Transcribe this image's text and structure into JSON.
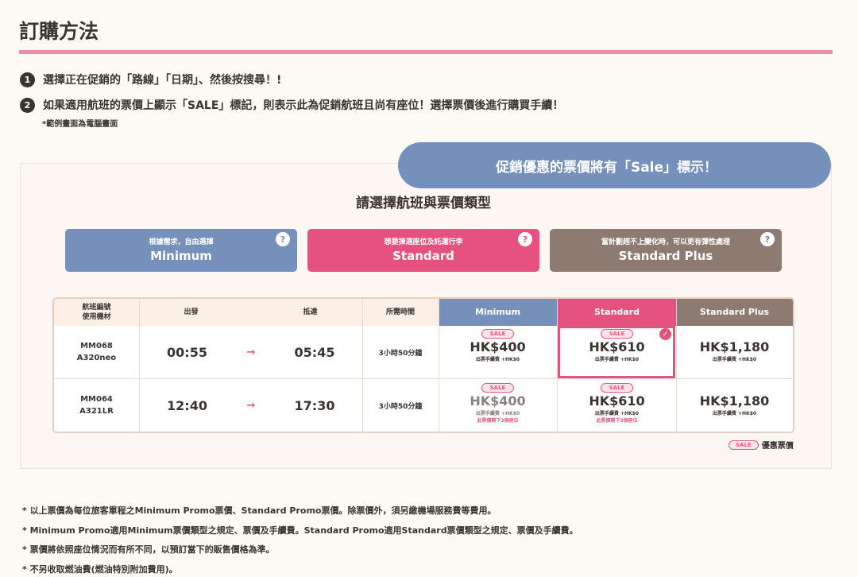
{
  "page": {
    "title": "訂購方法"
  },
  "steps": [
    {
      "num": "1",
      "text": "選擇正在促銷的「路線」「日期」、然後按搜尋！!"
    },
    {
      "num": "2",
      "text": "如果適用航班的票價上顯示「SALE」標記，則表示此為促銷航班且尚有座位！選擇票價後進行購買手續！"
    }
  ],
  "step_note": "*範例畫面為電腦畫面",
  "callout": "促銷優惠的票價將有「Sale」標示！",
  "select_title": "請選擇航班與票價類型",
  "fare_types": [
    {
      "desc": "根據需求，自由選擇",
      "name": "Minimum",
      "help": "?",
      "color": "#7591bb"
    },
    {
      "desc": "想要揀選座位及託運行李",
      "name": "Standard",
      "help": "?",
      "color": "#e5527f"
    },
    {
      "desc": "當計劃趕不上變化時，可以更有彈性處理",
      "name": "Standard Plus",
      "help": "?",
      "color": "#8d7b72"
    }
  ],
  "table": {
    "headers": {
      "flight_line1": "航班編號",
      "flight_line2": "使用機材",
      "depart": "出發",
      "arrive": "抵達",
      "duration": "所需時間",
      "minimum": "Minimum",
      "standard": "Standard",
      "standard_plus": "Standard Plus"
    },
    "rows": [
      {
        "flight_no": "MM068",
        "aircraft": "A320neo",
        "depart": "00:55",
        "arrow": "→",
        "arrive": "05:45",
        "duration": "3小時50分鐘",
        "minimum": {
          "sale": "SALE",
          "price": "HK$400",
          "fee": "出票手續費 +HK$0"
        },
        "standard": {
          "sale": "SALE",
          "price": "HK$610",
          "fee": "出票手續費 +HK$0",
          "check": "✓"
        },
        "standard_plus": {
          "price": "HK$1,180",
          "fee": "出票手續費 +HK$0"
        }
      },
      {
        "flight_no": "MM064",
        "aircraft": "A321LR",
        "depart": "12:40",
        "arrow": "→",
        "arrive": "17:30",
        "duration": "3小時50分鐘",
        "minimum": {
          "sale": "SALE",
          "price": "HK$400",
          "fee": "出票手續費 +HK$0",
          "note": "此票價剩下3個座位"
        },
        "standard": {
          "sale": "SALE",
          "price": "HK$610",
          "fee": "出票手續費 +HK$0",
          "note": "此票價剩下3個座位"
        },
        "standard_plus": {
          "price": "HK$1,180",
          "fee": "出票手續費 +HK$0"
        }
      }
    ]
  },
  "legend": {
    "badge": "SALE",
    "label": "優惠票價"
  },
  "footnotes": [
    "* 以上票價為每位旅客單程之Minimum Promo票價、Standard Promo票價。除票價外，須另繳機場服務費等費用。",
    "* Minimum Promo適用Minimum票價類型之規定、票價及手續費。Standard Promo適用Standard票價類型之規定、票價及手續費。",
    "* 票價將依照座位情況而有所不同，以預訂當下的販售價格為準。",
    "* 不另收取燃油費(燃油特別附加費用)。"
  ],
  "colors": {
    "accent_pink": "#ee8ca5",
    "minimum_blue": "#7591bb",
    "standard_pink": "#e5527f",
    "standard_plus_brown": "#8d7b72"
  }
}
